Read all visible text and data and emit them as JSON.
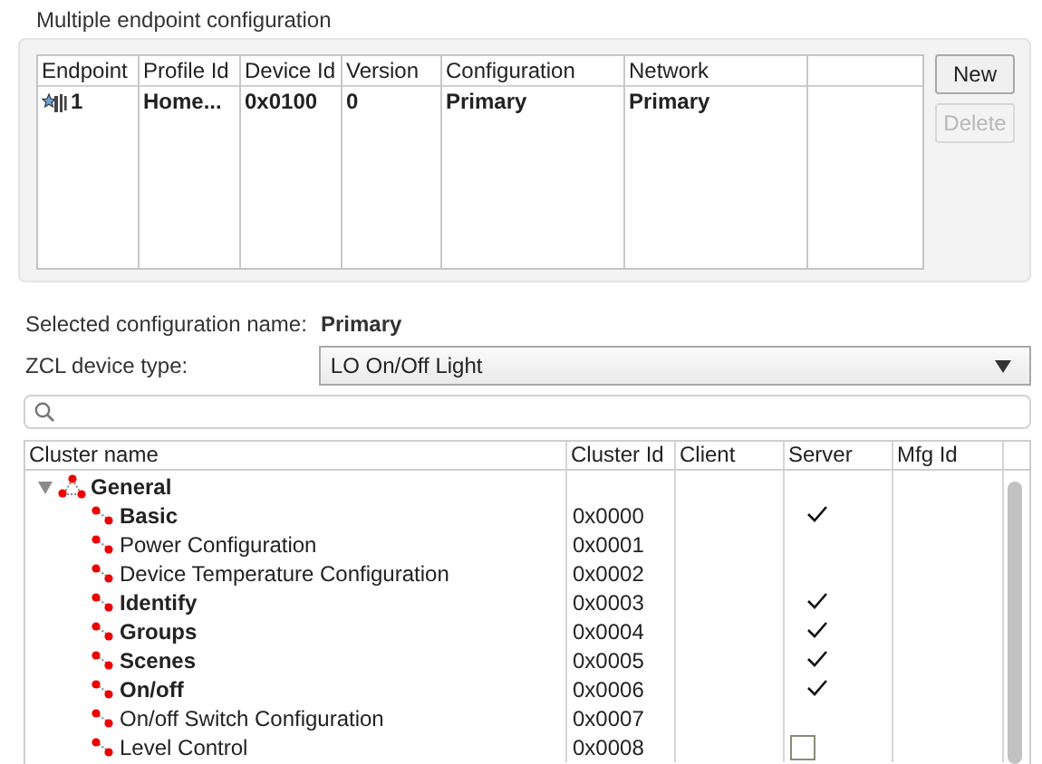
{
  "group_title": "Multiple endpoint configuration",
  "endpoint_table": {
    "columns": [
      "Endpoint",
      "Profile Id",
      "Device Id",
      "Version",
      "Configuration",
      "Network"
    ],
    "rows": [
      {
        "cells": [
          "1",
          "Home...",
          "0x0100",
          "0",
          "Primary",
          "Primary"
        ]
      }
    ]
  },
  "buttons": [
    {
      "label": "New",
      "disabled": false
    },
    {
      "label": "Delete",
      "disabled": true
    }
  ],
  "selected_configuration": {
    "label": "Selected configuration name:",
    "value": "Primary"
  },
  "zcl_device_type": {
    "label": "ZCL device type:",
    "value": "LO On/Off Light"
  },
  "cluster_table": {
    "columns": [
      "Cluster name",
      "Cluster Id",
      "Client",
      "Server",
      "Mfg Id"
    ],
    "tree": [
      {
        "name": "General",
        "expanded": true,
        "children": [
          {
            "name": "Basic",
            "cluster_id": "0x0000",
            "enabled": true,
            "server": true,
            "editing": false
          },
          {
            "name": "Power Configuration",
            "cluster_id": "0x0001",
            "enabled": false,
            "server": false,
            "editing": false
          },
          {
            "name": "Device Temperature Configuration",
            "cluster_id": "0x0002",
            "enabled": false,
            "server": false,
            "editing": false
          },
          {
            "name": "Identify",
            "cluster_id": "0x0003",
            "enabled": true,
            "server": true,
            "editing": false
          },
          {
            "name": "Groups",
            "cluster_id": "0x0004",
            "enabled": true,
            "server": true,
            "editing": false
          },
          {
            "name": "Scenes",
            "cluster_id": "0x0005",
            "enabled": true,
            "server": true,
            "editing": false
          },
          {
            "name": "On/off",
            "cluster_id": "0x0006",
            "enabled": true,
            "server": true,
            "editing": false
          },
          {
            "name": "On/off Switch Configuration",
            "cluster_id": "0x0007",
            "enabled": false,
            "server": false,
            "editing": false
          },
          {
            "name": "Level Control",
            "cluster_id": "0x0008",
            "enabled": false,
            "server": false,
            "editing": true
          }
        ]
      }
    ]
  }
}
